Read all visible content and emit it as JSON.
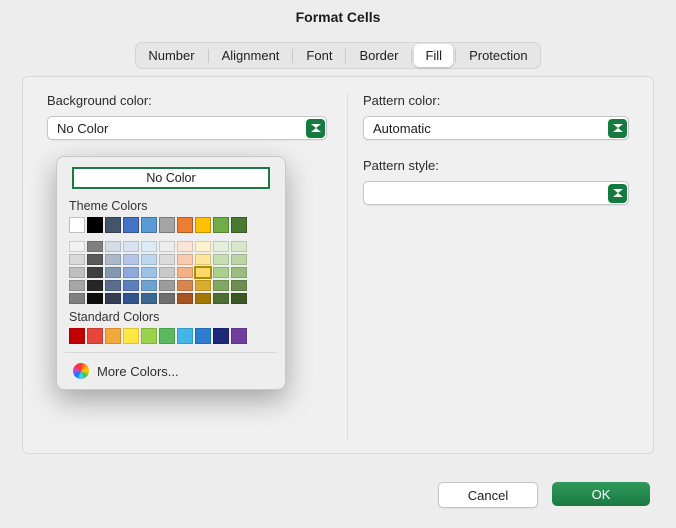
{
  "title": "Format Cells",
  "tabs": [
    "Number",
    "Alignment",
    "Font",
    "Border",
    "Fill",
    "Protection"
  ],
  "active_tab": "Fill",
  "left": {
    "bg_label": "Background color:",
    "bg_value": "No Color"
  },
  "right": {
    "pc_label": "Pattern color:",
    "pc_value": "Automatic",
    "ps_label": "Pattern style:",
    "ps_value": ""
  },
  "popup": {
    "selected": "No Color",
    "theme_h": "Theme Colors",
    "theme_main": [
      "#ffffff",
      "#000000",
      "#44546a",
      "#4472c4",
      "#5b9bd5",
      "#a5a5a5",
      "#ed7d31",
      "#ffc000",
      "#70ad47",
      "#4a7a31"
    ],
    "theme_shades": [
      [
        "#f2f2f2",
        "#7f7f7f",
        "#d6dce5",
        "#d9e1f2",
        "#ddebf7",
        "#ededed",
        "#fce4d6",
        "#fff2cc",
        "#e2efda",
        "#d9e7c9"
      ],
      [
        "#d9d9d9",
        "#595959",
        "#adb9ca",
        "#b4c6e7",
        "#bdd7ee",
        "#dbdbdb",
        "#f8cbad",
        "#ffe699",
        "#c6e0b4",
        "#bcd5a5"
      ],
      [
        "#bfbfbf",
        "#404040",
        "#8497b0",
        "#8ea9db",
        "#9bc2e6",
        "#c9c9c9",
        "#f4b084",
        "#ffd966",
        "#a9d08e",
        "#9cbd7e"
      ],
      [
        "#a6a6a6",
        "#262626",
        "#5a6d8a",
        "#5c7fbc",
        "#6fa3cf",
        "#9c9c9c",
        "#d9854e",
        "#d9ad2d",
        "#7fa860",
        "#6e8e50"
      ],
      [
        "#808080",
        "#0d0d0d",
        "#343d52",
        "#32548e",
        "#3b6893",
        "#6e6e6e",
        "#a85420",
        "#a17900",
        "#4d7030",
        "#3c5825"
      ]
    ],
    "std_h": "Standard Colors",
    "std": [
      "#c00000",
      "#e8443a",
      "#f2a93c",
      "#ffe640",
      "#9bd24c",
      "#5cb85c",
      "#42b6e8",
      "#2f7dd1",
      "#1e2a78",
      "#6f3fa0"
    ],
    "more": "More Colors..."
  },
  "footer": {
    "cancel": "Cancel",
    "ok": "OK"
  },
  "highlight_index": 7
}
